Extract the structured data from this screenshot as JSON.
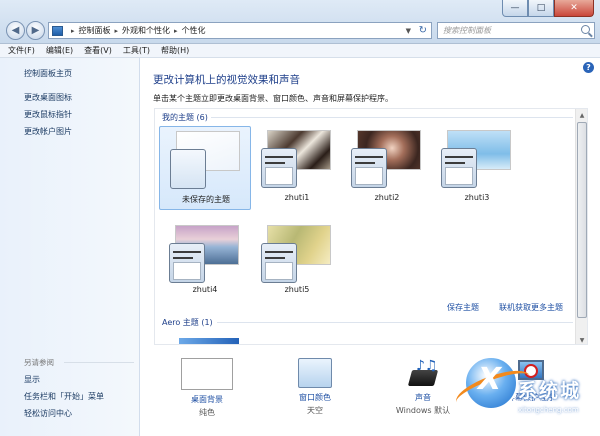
{
  "window": {
    "controls": {
      "minimize": "—",
      "maximize": "□",
      "close": "✕"
    }
  },
  "nav": {
    "back": "◀",
    "forward": "▶"
  },
  "address": {
    "crumbs": [
      "控制面板",
      "外观和个性化",
      "个性化"
    ],
    "separator": "▸",
    "icon": "control-panel-icon"
  },
  "search": {
    "placeholder": "搜索控制面板"
  },
  "menu": {
    "items": [
      "文件(F)",
      "编辑(E)",
      "查看(V)",
      "工具(T)",
      "帮助(H)"
    ]
  },
  "sidebar": {
    "home": "控制面板主页",
    "links": [
      "更改桌面图标",
      "更改鼠标指针",
      "更改帐户图片"
    ],
    "see_also": "另请参阅",
    "see_also_links": [
      "显示",
      "任务栏和「开始」菜单",
      "轻松访问中心"
    ]
  },
  "main": {
    "help": "?",
    "title": "更改计算机上的视觉效果和声音",
    "subtitle": "单击某个主题立即更改桌面背景、窗口颜色、声音和屏幕保护程序。",
    "my_themes_header": "我的主题 (6)",
    "aero_header": "Aero 主题 (1)",
    "themes": [
      {
        "name": "未保存的主题",
        "selected": true
      },
      {
        "name": "zhuti1"
      },
      {
        "name": "zhuti2"
      },
      {
        "name": "zhuti3"
      },
      {
        "name": "zhuti4"
      },
      {
        "name": "zhuti5"
      }
    ],
    "save_theme": "保存主题",
    "get_more": "联机获取更多主题"
  },
  "bottom": {
    "items": [
      {
        "label": "桌面背景",
        "sub": "纯色",
        "icon": "desktop-background-icon"
      },
      {
        "label": "窗口颜色",
        "sub": "天空",
        "icon": "window-color-icon"
      },
      {
        "label": "声音",
        "sub": "Windows 默认",
        "icon": "sound-icon"
      },
      {
        "label": "屏幕保护程序",
        "sub": "",
        "icon": "screensaver-icon"
      }
    ]
  },
  "watermark": {
    "brand": "系统城",
    "url": "xitongcheng.com"
  },
  "colors": {
    "accent": "#1e3f8a",
    "link": "#1e4fa3",
    "selected": "#d6e8fb"
  }
}
